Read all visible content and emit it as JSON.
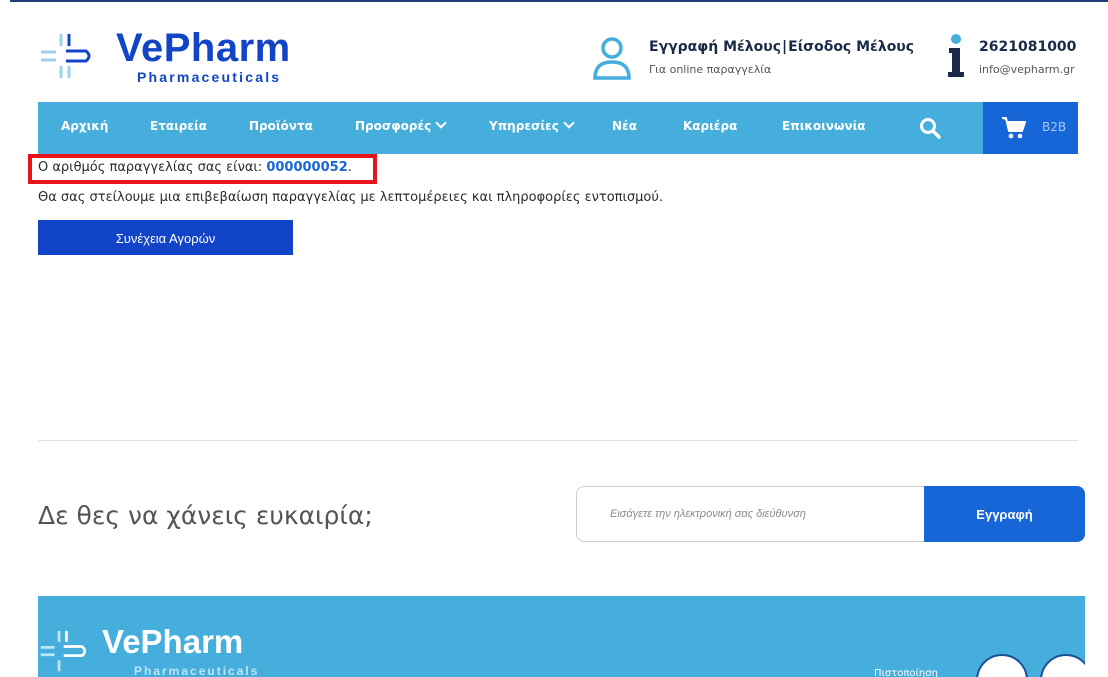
{
  "header": {
    "brand": "VePharm",
    "brand_sub": "Pharmaceuticals",
    "register_label": "Εγγραφή Μέλους",
    "login_label": "Είσοδος Μέλους",
    "member_sub": "Για online παραγγελία",
    "phone": "2621081000",
    "email": "info@vepharm.gr"
  },
  "nav": {
    "items": [
      "Αρχική",
      "Εταιρεία",
      "Προϊόντα",
      "Προσφορές",
      "Υπηρεσίες",
      "Νέα",
      "Καριέρα",
      "Επικοινωνία"
    ],
    "cart_label": "B2B"
  },
  "order": {
    "prefix": "Ο αριθμός παραγγελίας σας είναι: ",
    "number": "000000052",
    "suffix": ".",
    "confirmation": "Θα σας στείλουμε μια επιβεβαίωση παραγγελίας με λεπτομέρειες και πληροφορίες εντοπισμού.",
    "continue_label": "Συνέχεια Αγορών"
  },
  "newsletter": {
    "title": "Δε θες να χάνεις ευκαιρία;",
    "placeholder": "Εισάγετε την ηλεκτρονική σας διεύθυνση",
    "button_label": "Εγγραφή"
  },
  "footer": {
    "brand": "VePharm",
    "brand_sub": "Pharmaceuticals",
    "right_text": "Πιστοποίηση"
  },
  "colors": {
    "brand_blue": "#1244c8",
    "nav_bg": "#45aedc",
    "cart_bg": "#1766d8",
    "highlight": "#e8141c"
  },
  "icons": [
    "logo-mark-icon",
    "user-icon",
    "info-icon",
    "chevron-down-icon",
    "search-icon",
    "cart-icon"
  ]
}
